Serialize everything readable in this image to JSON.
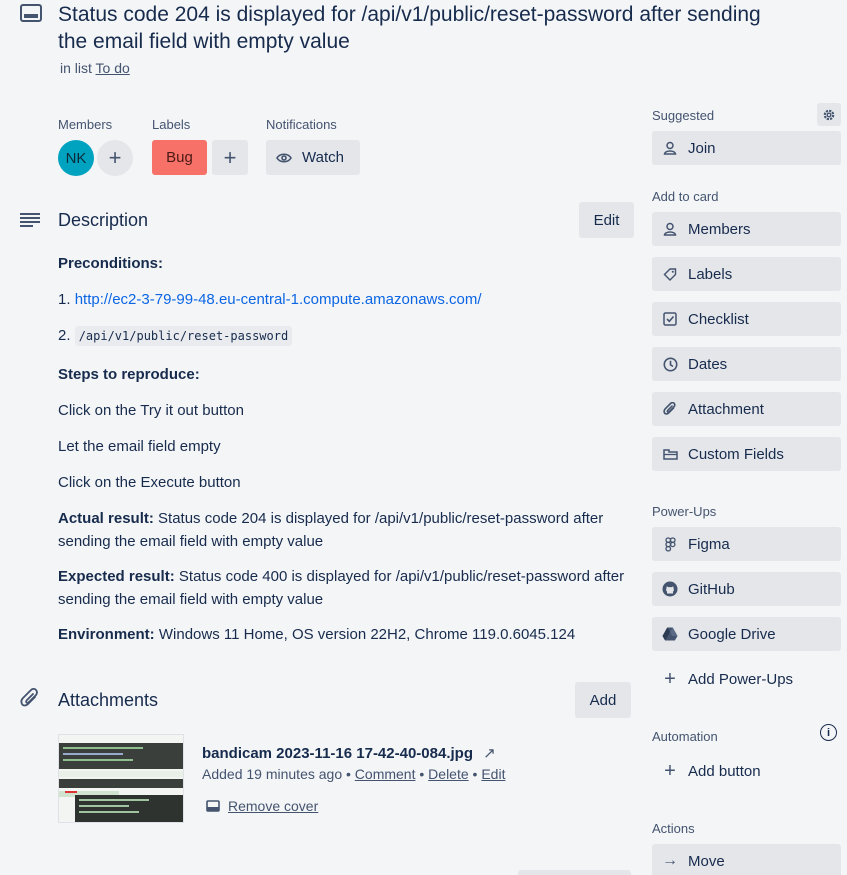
{
  "card": {
    "title": "Status code 204 is displayed for /api/v1/public/reset-password after sending the email field with empty value",
    "in_list_prefix": "in list",
    "list_name": "To do"
  },
  "members": {
    "heading": "Members",
    "avatar_initials": "NK"
  },
  "labels": {
    "heading": "Labels",
    "items": [
      "Bug"
    ]
  },
  "notifications": {
    "heading": "Notifications",
    "watch_label": "Watch"
  },
  "description": {
    "heading": "Description",
    "edit_label": "Edit",
    "preconditions_label": "Preconditions:",
    "item1_num": "1.",
    "item1_link": "http://ec2-3-79-99-48.eu-central-1.compute.amazonaws.com/",
    "item2_num": "2.",
    "item2_code": "/api/v1/public/reset-password",
    "steps_label": "Steps to reproduce:",
    "steps": [
      "Click on the Try it out button",
      "Let the email field empty",
      "Click on the Execute button"
    ],
    "actual_label": "Actual result:",
    "actual_text": "Status code 204 is displayed for /api/v1/public/reset-password after sending the email field with empty value",
    "expected_label": "Expected result:",
    "expected_text": "Status code 400 is displayed for /api/v1/public/reset-password after sending the email field with empty value",
    "environment_label": "Environment:",
    "environment_text": "Windows 11 Home, OS version 22H2, Chrome 119.0.6045.124"
  },
  "attachments": {
    "heading": "Attachments",
    "add_label": "Add",
    "file_name": "bandicam 2023-11-16 17-42-40-084.jpg",
    "added_text": "Added 19 minutes ago",
    "sep": "•",
    "comment_label": "Comment",
    "delete_label": "Delete",
    "edit_label": "Edit",
    "remove_cover_label": "Remove cover"
  },
  "sidebar": {
    "suggested_heading": "Suggested",
    "join_label": "Join",
    "add_to_card_heading": "Add to card",
    "add_to_card": [
      {
        "label": "Members",
        "icon": "person-icon"
      },
      {
        "label": "Labels",
        "icon": "tag-icon"
      },
      {
        "label": "Checklist",
        "icon": "checklist-icon"
      },
      {
        "label": "Dates",
        "icon": "clock-icon"
      },
      {
        "label": "Attachment",
        "icon": "paperclip-icon"
      },
      {
        "label": "Custom Fields",
        "icon": "custom-fields-icon"
      }
    ],
    "powerups_heading": "Power-Ups",
    "powerups": [
      {
        "label": "Figma",
        "icon": "figma-icon"
      },
      {
        "label": "GitHub",
        "icon": "github-icon"
      },
      {
        "label": "Google Drive",
        "icon": "google-drive-icon"
      }
    ],
    "add_powerups_label": "Add Power-Ups",
    "automation_heading": "Automation",
    "add_button_label": "Add button",
    "actions_heading": "Actions",
    "move_label": "Move"
  },
  "colors": {
    "bug_label": "#f87168",
    "link": "#0c66e4",
    "avatar": "#00a3bf"
  }
}
